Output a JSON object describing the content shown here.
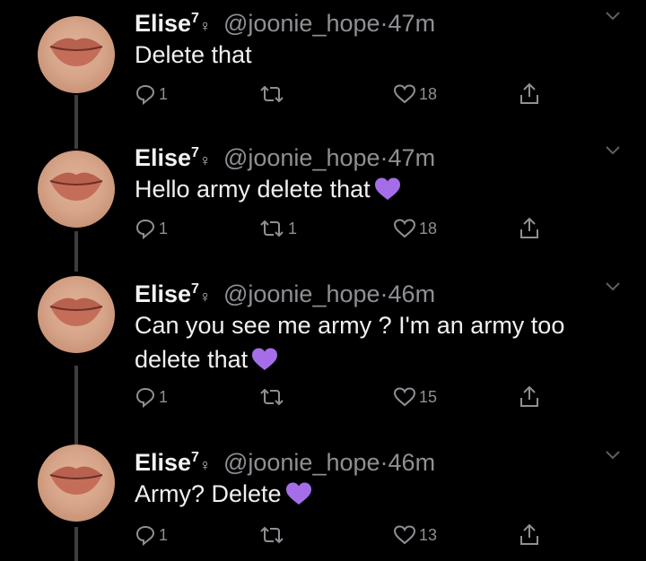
{
  "tweets": [
    {
      "name": "Elise",
      "sup": "7",
      "flower": "♀",
      "handle": "@joonie_hope",
      "dot": "·",
      "time": "47m",
      "text": "Delete that",
      "emoji": "",
      "replies": "1",
      "retweets": "",
      "likes": "18"
    },
    {
      "name": "Elise",
      "sup": "7",
      "flower": "♀",
      "handle": "@joonie_hope",
      "dot": "·",
      "time": "47m",
      "text": "Hello army delete that",
      "emoji": "purple-heart",
      "replies": "1",
      "retweets": "1",
      "likes": "18"
    },
    {
      "name": "Elise",
      "sup": "7",
      "flower": "♀",
      "handle": "@joonie_hope",
      "dot": "·",
      "time": "46m",
      "text": "Can you see me army ? I'm an army too delete that",
      "emoji": "purple-heart",
      "replies": "1",
      "retweets": "",
      "likes": "15"
    },
    {
      "name": "Elise",
      "sup": "7",
      "flower": "♀",
      "handle": "@joonie_hope",
      "dot": "·",
      "time": "46m",
      "text": "Army? Delete",
      "emoji": "purple-heart",
      "replies": "1",
      "retweets": "",
      "likes": "13"
    }
  ],
  "colors": {
    "background": "#000000",
    "muted": "#8f8f95",
    "text": "#f0f0f0",
    "heart_emoji": "#a56ee8"
  }
}
